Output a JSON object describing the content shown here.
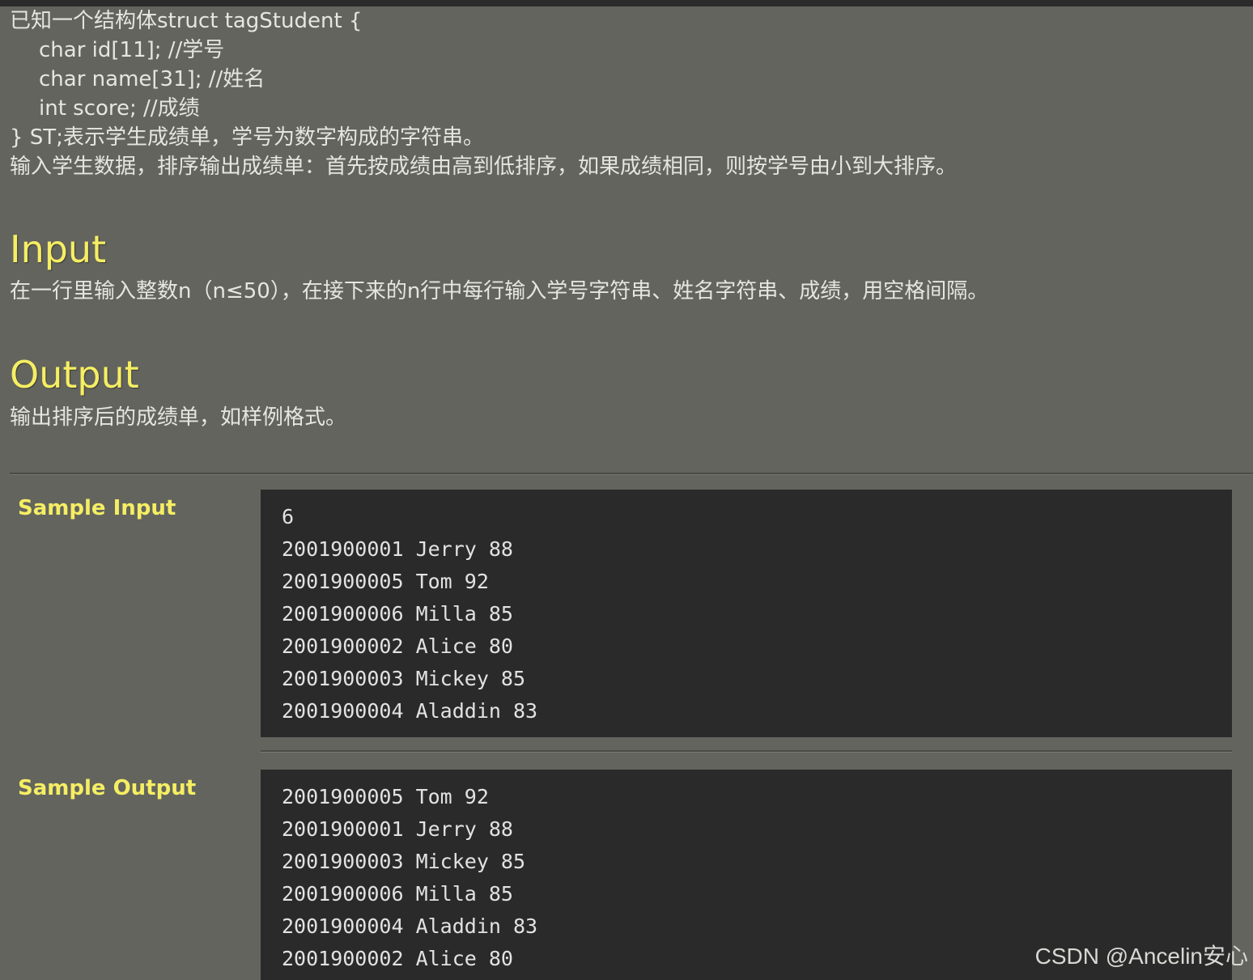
{
  "problem": {
    "lines": [
      "已知一个结构体struct tagStudent {",
      "char id[11]; //学号",
      "char name[31]; //姓名",
      "int score; //成绩",
      "} ST;表示学生成绩单，学号为数字构成的字符串。",
      "输入学生数据，排序输出成绩单：首先按成绩由高到低排序，如果成绩相同，则按学号由小到大排序。"
    ]
  },
  "input_section": {
    "title": "Input",
    "text": "在一行里输入整数n（n≤50），在接下来的n行中每行输入学号字符串、姓名字符串、成绩，用空格间隔。"
  },
  "output_section": {
    "title": "Output",
    "text": "输出排序后的成绩单，如样例格式。"
  },
  "sample_input": {
    "label": "Sample Input",
    "lines": [
      "6",
      "2001900001 Jerry 88",
      "2001900005 Tom 92",
      "2001900006 Milla 85",
      "2001900002 Alice 80",
      "2001900003 Mickey 85",
      "2001900004 Aladdin 83"
    ]
  },
  "sample_output": {
    "label": "Sample Output",
    "lines": [
      "2001900005 Tom 92",
      "2001900001 Jerry 88",
      "2001900003 Mickey 85",
      "2001900006 Milla 85",
      "2001900004 Aladdin 83",
      "2001900002 Alice 80"
    ]
  },
  "watermark": "CSDN @Ancelin安心",
  "colors": {
    "background": "#63645e",
    "heading": "#f5ee63",
    "code_background": "#2a2a2a"
  }
}
